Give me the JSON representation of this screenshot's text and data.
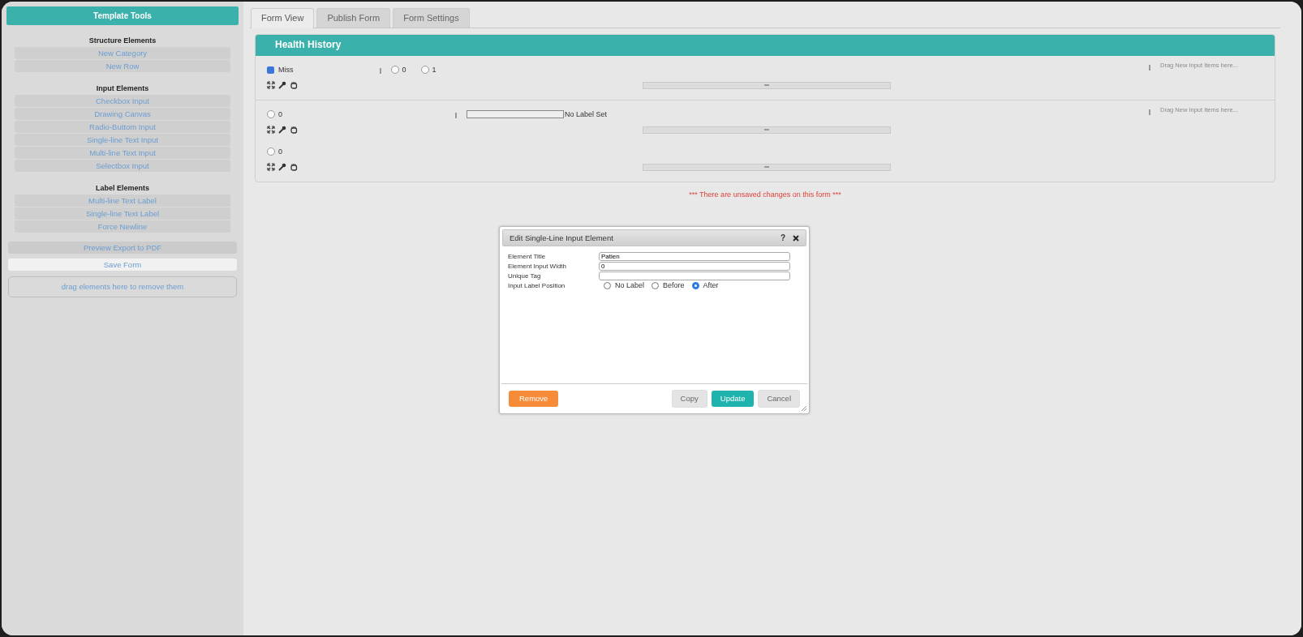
{
  "sidebar": {
    "title": "Template Tools",
    "sections": [
      {
        "heading": "Structure Elements",
        "items": [
          "New Category",
          "New Row"
        ]
      },
      {
        "heading": "Input Elements",
        "items": [
          "Checkbox Input",
          "Drawing Canvas",
          "Radio-Buttom Input",
          "Single-line Text Input",
          "Multi-line Text Input",
          "Selectbox Input"
        ]
      },
      {
        "heading": "Label Elements",
        "items": [
          "Multi-line Text Label",
          "Single-line Text Label",
          "Force Newline"
        ]
      }
    ],
    "actions": [
      {
        "label": "Preview Export to PDF",
        "kind": "secondary"
      },
      {
        "label": "Save Form",
        "kind": "light"
      }
    ],
    "trash_zone": "drag elements here to remove them"
  },
  "tabs": [
    {
      "label": "Form View",
      "selected": true
    },
    {
      "label": "Publish Form",
      "selected": false
    },
    {
      "label": "Form Settings",
      "selected": false
    }
  ],
  "category": {
    "title": "Health History",
    "rows": [
      {
        "blocks": [
          {
            "controls": [
              {
                "kind": "checkbox",
                "label": "Miss",
                "checked": true
              },
              {
                "kind": "handle"
              },
              {
                "kind": "radio",
                "label": "0",
                "checked": false
              },
              {
                "kind": "radio",
                "label": "1",
                "checked": false
              }
            ]
          }
        ],
        "dropzone": "Drag New Input Items here..."
      },
      {
        "blocks": [
          {
            "controls": [
              {
                "kind": "radio",
                "label": "0",
                "checked": false
              },
              {
                "kind": "handle"
              },
              {
                "kind": "textbox"
              },
              {
                "kind": "text",
                "label": "No Label Set"
              }
            ]
          },
          {
            "controls": [
              {
                "kind": "radio",
                "label": "0",
                "checked": false
              }
            ]
          }
        ],
        "dropzone": "Drag New Input Items here..."
      }
    ]
  },
  "notice": "*** There are unsaved changes on this form ***",
  "dialog": {
    "title": "Edit Single-Line Input Element",
    "help": "?",
    "fields": [
      {
        "label": "Element Title",
        "value": "Patien"
      },
      {
        "label": "Element Input Width",
        "value": "0"
      },
      {
        "label": "Unique Tag"
      }
    ],
    "label_position": {
      "label": "Input Label Position",
      "options": [
        {
          "label": "No Label",
          "selected": false
        },
        {
          "label": "Before",
          "selected": false
        },
        {
          "label": "After",
          "selected": true
        }
      ]
    },
    "buttons": [
      {
        "label": "Remove",
        "kind": "danger"
      },
      {
        "label": "Copy",
        "kind": "default"
      },
      {
        "label": "Update",
        "kind": "primary"
      },
      {
        "label": "Cancel",
        "kind": "default"
      }
    ]
  }
}
